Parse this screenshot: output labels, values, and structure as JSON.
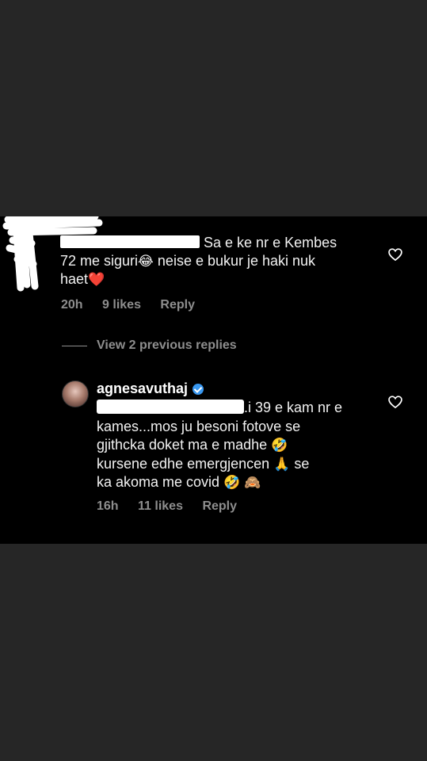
{
  "comment": {
    "text_line1": "Sa e ke nr e Kembes",
    "text_line2a": "72 me siguri",
    "emoji_laugh": "😂",
    "text_line2b": " neise e bukur je haki nuk",
    "text_line3": "haet",
    "emoji_heart": "❤️",
    "time": "20h",
    "likes": "9 likes",
    "reply_label": "Reply"
  },
  "view_previous": "View 2 previous replies",
  "reply": {
    "username": "agnesavuthaj",
    "text_line1": ".i 39 e kam nr e",
    "text_line2": "kames...mos ju besoni fotove se",
    "text_line3": "gjithcka doket ma e madhe ",
    "emoji_rofl": "🤣",
    "text_line4a": "kursene edhe emergjencen ",
    "emoji_pray": "🙏",
    "text_line4b": " se",
    "text_line5": "ka akoma me covid ",
    "emoji_rofl2": "🤣",
    "emoji_monkey": "🙈",
    "time": "16h",
    "likes": "11 likes",
    "reply_label": "Reply"
  },
  "colors": {
    "background": "#262626",
    "panel": "#000000",
    "text": "#f2f2f2",
    "muted": "#8e8e8e",
    "verified": "#3897f0"
  },
  "icons": [
    "heart-icon",
    "verified-badge-icon"
  ]
}
